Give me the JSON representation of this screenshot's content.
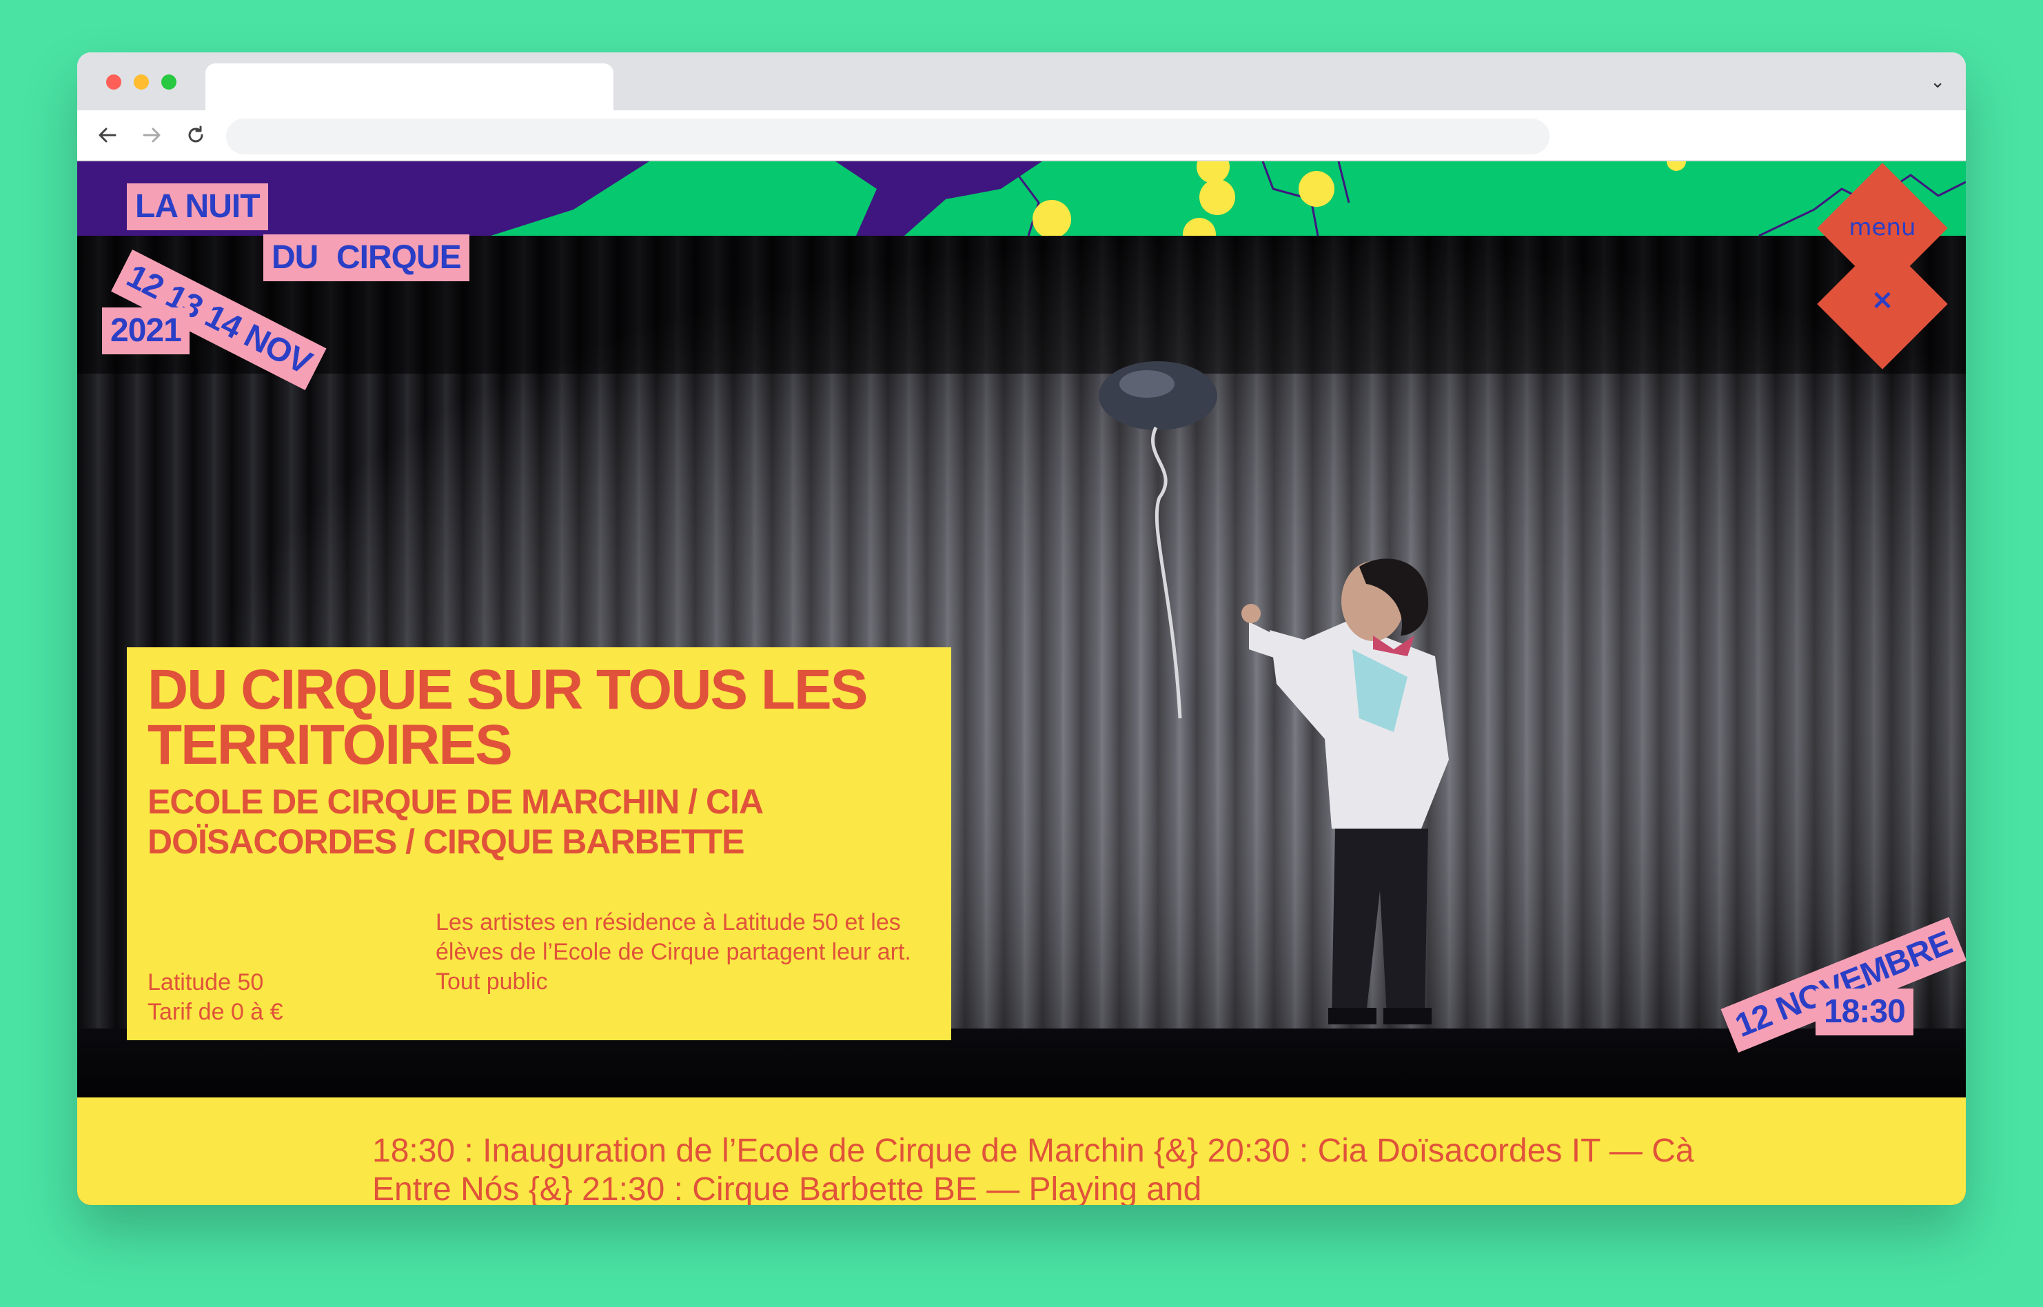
{
  "browser": {
    "back_icon": "arrow-left-icon",
    "forward_icon": "arrow-right-icon",
    "reload_icon": "reload-icon",
    "chevron_icon": "chevron-down-icon",
    "url": ""
  },
  "logo": {
    "line1": "LA NUIT",
    "line2_a": "DU",
    "line2_b": "CIRQUE",
    "dates": "12 13 14 NOV",
    "year": "2021"
  },
  "menu": {
    "label": "menu",
    "close_icon": "×"
  },
  "event": {
    "title": "DU CIRQUE SUR TOUS LES TERRITOIRES",
    "subtitle": "ECOLE DE CIRQUE DE MARCHIN / CIA DOÏSACORDES / CIRQUE BARBETTE",
    "venue": "Latitude 50",
    "price": "Tarif de 0 à €",
    "description": "Les artistes en résidence à Latitude 50 et les élèves de l’Ecole de Cirque partagent leur art.",
    "audience": "Tout public",
    "date": "12 NOVEMBRE",
    "time": "18:30"
  },
  "program": {
    "text": "18:30 : Inauguration de l’Ecole de Cirque de Marchin {&} 20:30 : Cia Doïsacordes IT — Cà Entre Nós {&} 21:30 : Cirque Barbette BE — Playing and"
  },
  "colors": {
    "page_bg": "#4ae3a4",
    "purple": "#3f1680",
    "green": "#06c86e",
    "yellow": "#fbe745",
    "pink": "#f6a0b6",
    "blue": "#2a3fc6",
    "red": "#e0523a"
  }
}
